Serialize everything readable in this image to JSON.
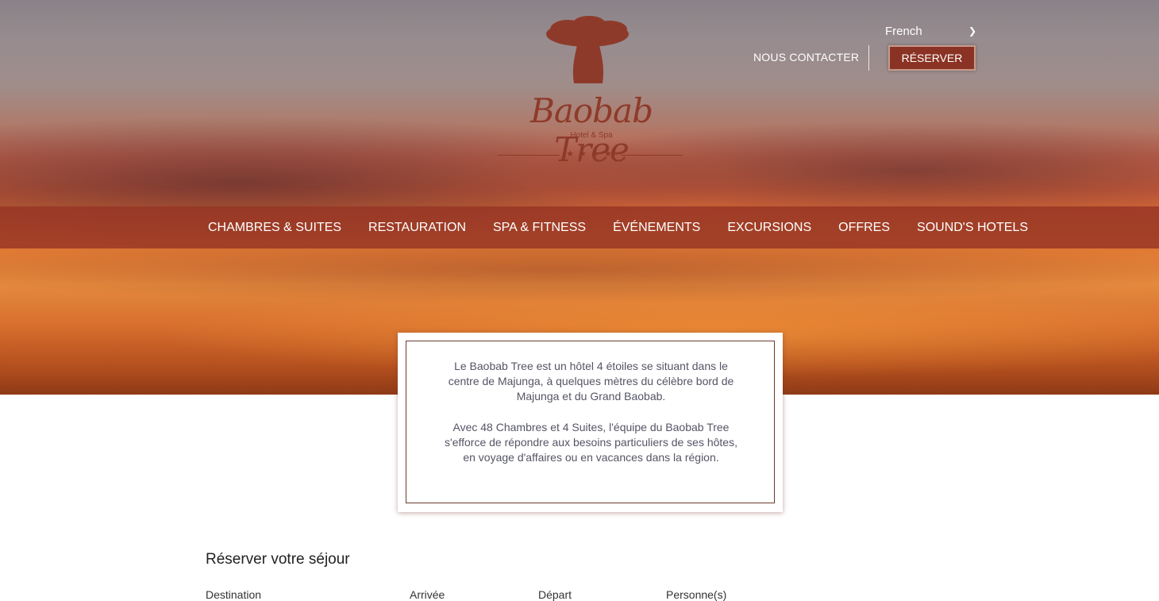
{
  "brand": {
    "name": "Baobab Tree",
    "subtitle": "Hotel & Spa",
    "stars": "★★★★"
  },
  "header": {
    "language": "French",
    "contact_label": "NOUS CONTACTER",
    "reserve_label": "RÉSERVER"
  },
  "nav": {
    "items": [
      {
        "label": "CHAMBRES & SUITES"
      },
      {
        "label": "RESTAURATION"
      },
      {
        "label": "SPA & FITNESS"
      },
      {
        "label": "ÉVÉNEMENTS"
      },
      {
        "label": "EXCURSIONS"
      },
      {
        "label": "OFFRES"
      },
      {
        "label": "SOUND'S HOTELS"
      }
    ]
  },
  "intro": {
    "paragraph1": "Le Baobab Tree est un hôtel 4 étoiles se situant dans le centre de Majunga, à quelques mètres du célèbre bord de Majunga et du Grand Baobab.",
    "paragraph2": "Avec 48 Chambres et 4 Suites, l'équipe du Baobab Tree s'efforce de répondre aux besoins particuliers de ses hôtes, en voyage d'affaires ou en vacances dans la région."
  },
  "booking": {
    "title": "Réserver votre séjour",
    "labels": {
      "destination": "Destination",
      "arrival": "Arrivée",
      "departure": "Départ",
      "guests": "Personne(s)"
    }
  },
  "colors": {
    "brand_red": "#8a3324",
    "nav_bg": "#963424"
  }
}
